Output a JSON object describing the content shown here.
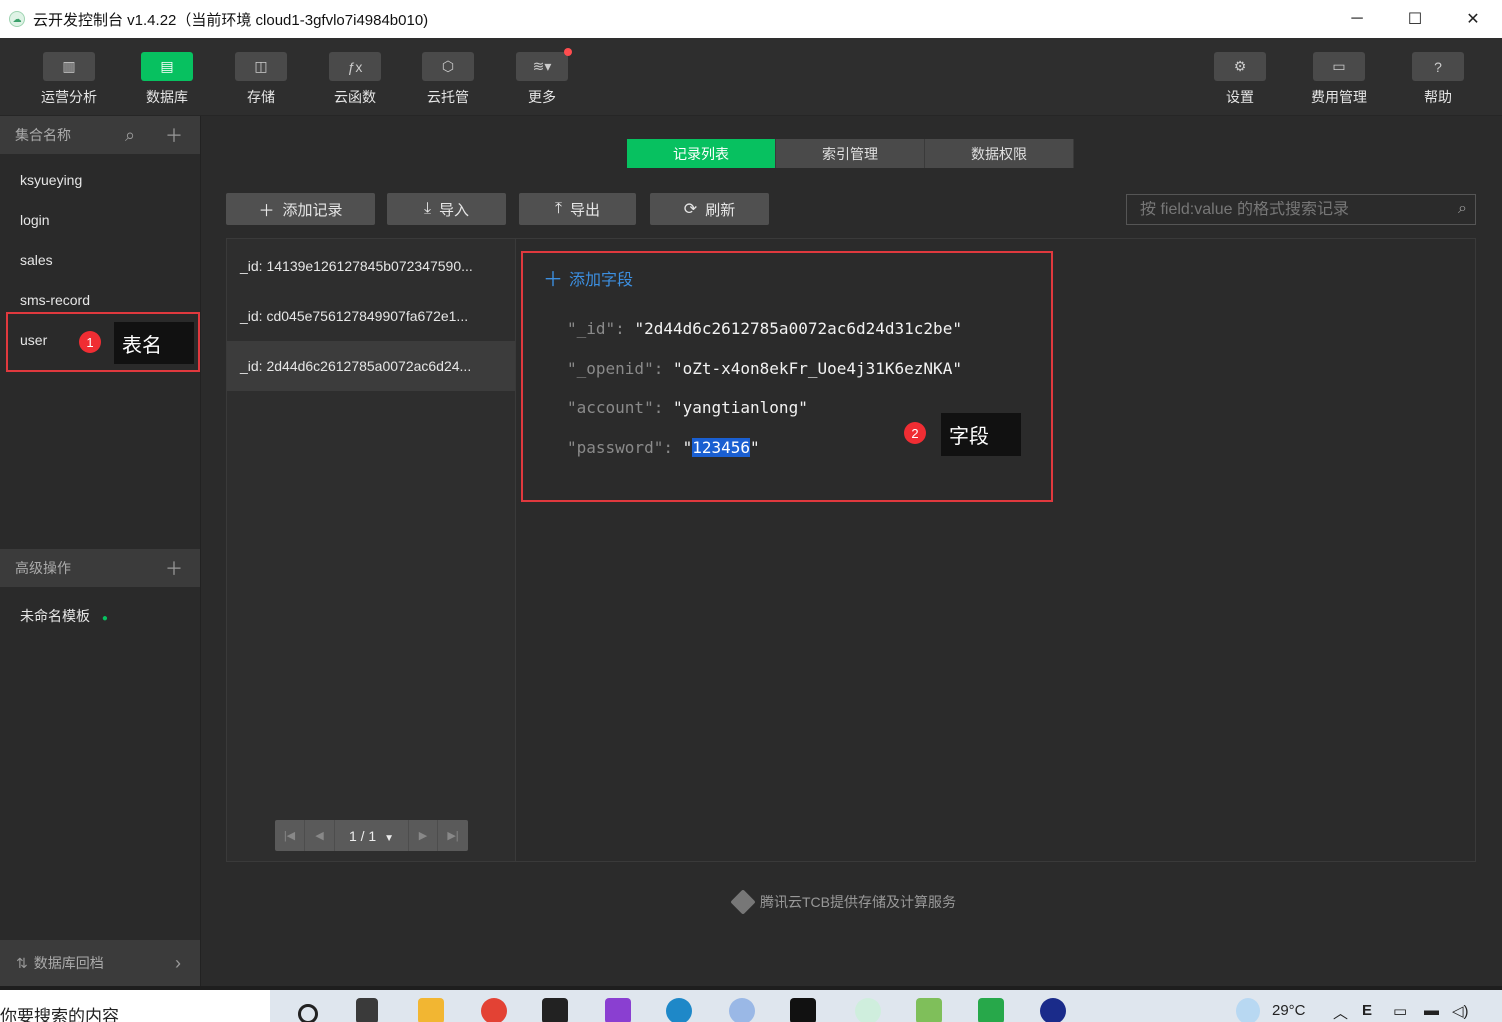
{
  "titlebar": {
    "title": "云开发控制台 v1.4.22（当前环境 cloud1-3gfvlo7i4984b010)",
    "minimize": "─",
    "maximize": "☐",
    "close": "✕"
  },
  "toolbar": {
    "items": [
      {
        "label": "运营分析",
        "icon": "chart-icon",
        "glyph": "▥"
      },
      {
        "label": "数据库",
        "icon": "database-icon",
        "glyph": "▤"
      },
      {
        "label": "存储",
        "icon": "save-icon",
        "glyph": "◫"
      },
      {
        "label": "云函数",
        "icon": "function-icon",
        "glyph": "ƒx"
      },
      {
        "label": "云托管",
        "icon": "cube-icon",
        "glyph": "⬡"
      },
      {
        "label": "更多",
        "icon": "layers-icon",
        "glyph": "≋▾"
      }
    ],
    "right_items": [
      {
        "label": "设置",
        "icon": "gear-icon",
        "glyph": "⚙"
      },
      {
        "label": "费用管理",
        "icon": "billing-icon",
        "glyph": "▭"
      },
      {
        "label": "帮助",
        "icon": "help-icon",
        "glyph": "?"
      }
    ]
  },
  "sidebar": {
    "header": "集合名称",
    "collections": [
      "ksyueying",
      "login",
      "sales",
      "sms-record",
      "user"
    ],
    "annotation_1": {
      "badge": "1",
      "text": "表名"
    },
    "advanced_header": "高级操作",
    "template_item": "未命名模板",
    "footer": "数据库回档"
  },
  "main": {
    "tabs": [
      "记录列表",
      "索引管理",
      "数据权限"
    ],
    "actions": {
      "add": "添加记录",
      "import": "导入",
      "export": "导出",
      "refresh": "刷新"
    },
    "search_placeholder": "按 field:value 的格式搜索记录",
    "records": [
      "_id: 14139e126127845b072347590...",
      "_id: cd045e756127849907fa672e1...",
      "_id: 2d44d6c2612785a0072ac6d24..."
    ],
    "pager": "1 / 1",
    "add_field": "添加字段",
    "document": {
      "id_key": "\"_id\":",
      "id_val": "\"2d44d6c2612785a0072ac6d24d31c2be\"",
      "openid_key": "\"_openid\":",
      "openid_val": "\"oZt-x4on8ekFr_Uoe4j31K6ezNKA\"",
      "account_key": "\"account\":",
      "account_val": "\"yangtianlong\"",
      "password_key": "\"password\":",
      "password_val": "123456"
    },
    "annotation_2": {
      "badge": "2",
      "text": "字段"
    },
    "footer_note": "腾讯云TCB提供存储及计算服务"
  },
  "taskbar": {
    "search_text": "你要搜索的内容",
    "temperature": "29°C"
  },
  "colors": {
    "accent": "#07c160",
    "highlight_border": "#e0393e",
    "link": "#3c8fe0"
  }
}
